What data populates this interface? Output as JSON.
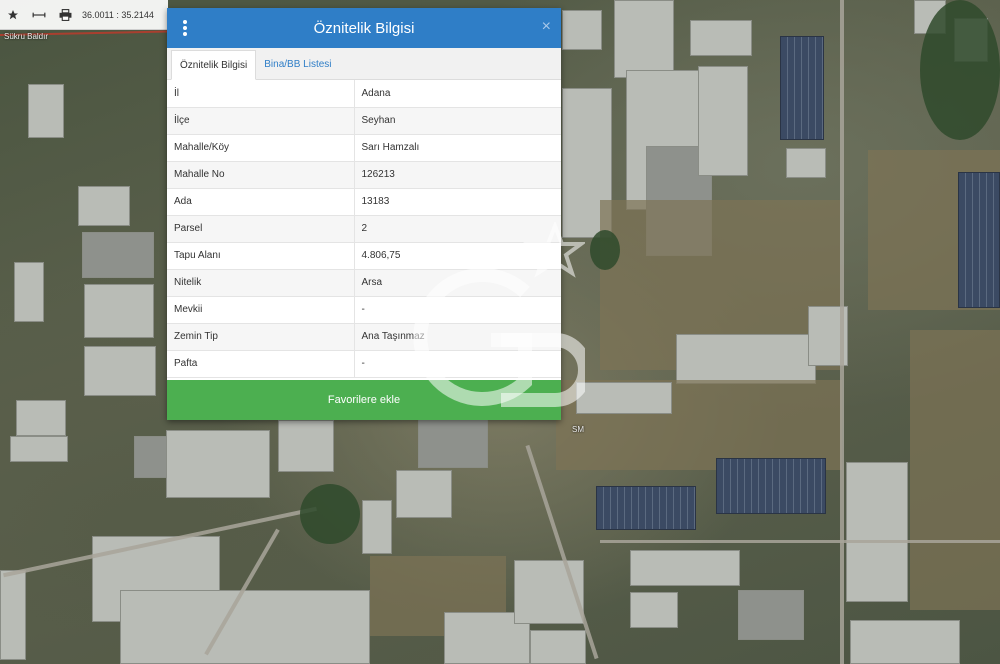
{
  "toolbar": {
    "coords": "36.0011 : 35.2144",
    "icons": [
      "star-icon",
      "measure-icon",
      "print-icon"
    ]
  },
  "map": {
    "street_label": "Sükru Baldır",
    "road_label": "SM"
  },
  "panel": {
    "title": "Öznitelik Bilgisi",
    "close": "×",
    "tabs": [
      {
        "label": "Öznitelik Bilgisi",
        "active": true
      },
      {
        "label": "Bina/BB Listesi",
        "active": false
      }
    ],
    "rows": [
      {
        "label": "İl",
        "value": "Adana"
      },
      {
        "label": "İlçe",
        "value": "Seyhan"
      },
      {
        "label": "Mahalle/Köy",
        "value": "Sarı Hamzalı"
      },
      {
        "label": "Mahalle No",
        "value": "126213"
      },
      {
        "label": "Ada",
        "value": "13183"
      },
      {
        "label": "Parsel",
        "value": "2"
      },
      {
        "label": "Tapu Alanı",
        "value": "4.806,75"
      },
      {
        "label": "Nitelik",
        "value": "Arsa"
      },
      {
        "label": "Mevkii",
        "value": "-"
      },
      {
        "label": "Zemin Tip",
        "value": "Ana Taşınmaz"
      },
      {
        "label": "Pafta",
        "value": "-"
      }
    ],
    "favorite_label": "Favorilere ekle"
  },
  "colors": {
    "header": "#2f7ec7",
    "favorite": "#4caf50",
    "tab_link": "#2f7ec7"
  }
}
